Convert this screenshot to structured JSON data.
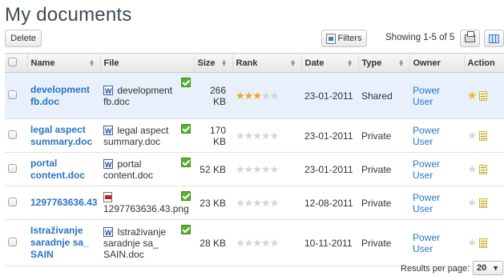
{
  "page": {
    "title": "My documents"
  },
  "toolbar": {
    "delete_label": "Delete",
    "filters_label": "Filters",
    "showing_text": "Showing 1-5 of 5",
    "print_icon": "print-icon",
    "columns_icon": "columns-icon"
  },
  "table": {
    "headers": {
      "name": "Name",
      "file": "File",
      "size": "Size",
      "rank": "Rank",
      "date": "Date",
      "type": "Type",
      "owner": "Owner",
      "action": "Action"
    },
    "rows": [
      {
        "name": "development fb.doc",
        "file": "development fb.doc",
        "file_icon": "word-doc-icon",
        "size": "266 KB",
        "rank": 3,
        "date": "23-01-2011",
        "type": "Shared",
        "owner": "Power User",
        "favorite": true
      },
      {
        "name": "legal aspect summary.doc",
        "file": "legal aspect summary.doc",
        "file_icon": "word-doc-icon",
        "size": "170 KB",
        "rank": 0,
        "date": "23-01-2011",
        "type": "Private",
        "owner": "Power User",
        "favorite": false
      },
      {
        "name": "portal content.doc",
        "file": "portal content.doc",
        "file_icon": "word-doc-icon",
        "size": "52 KB",
        "rank": 0,
        "date": "23-01-2011",
        "type": "Private",
        "owner": "Power User",
        "favorite": false
      },
      {
        "name": "1297763636.43",
        "file": "1297763636.43.png",
        "file_icon": "pdf-icon",
        "size": "23 KB",
        "rank": 0,
        "date": "12-08-2011",
        "type": "Private",
        "owner": "Power User",
        "favorite": false
      },
      {
        "name": "Istraživanje saradnje sa_ SAIN",
        "file": "Istraživanje saradnje sa_ SAIN.doc",
        "file_icon": "word-doc-icon",
        "size": "28 KB",
        "rank": 0,
        "date": "10-11-2011",
        "type": "Private",
        "owner": "Power User",
        "favorite": false
      }
    ],
    "max_rank": 5,
    "selected_row": 0
  },
  "footer": {
    "results_per_page_label": "Results per page:",
    "results_per_page_value": "20"
  },
  "colors": {
    "link": "#2a74c4",
    "star_on": "#f0a818",
    "selected_row_bg": "#e7f0fb"
  }
}
